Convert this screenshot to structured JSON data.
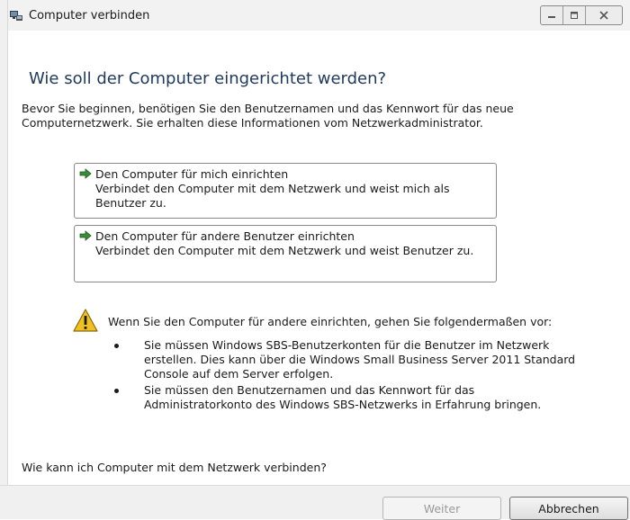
{
  "window": {
    "title": "Computer verbinden",
    "controls": [
      "minimize",
      "maximize",
      "close"
    ]
  },
  "page": {
    "heading": "Wie soll der Computer eingerichtet werden?",
    "intro": "Bevor Sie beginnen, benötigen Sie den Benutzernamen und das Kennwort für das neue Computernetzwerk. Sie erhalten diese Informationen vom Netzwerkadministrator."
  },
  "options": [
    {
      "title": "Den Computer für mich einrichten",
      "description": "Verbindet den Computer mit dem Netzwerk und weist mich als Benutzer zu."
    },
    {
      "title": "Den Computer für andere Benutzer einrichten",
      "description": "Verbindet den Computer mit dem Netzwerk und weist Benutzer zu."
    }
  ],
  "warning": {
    "text": "Wenn Sie den Computer für andere einrichten, gehen Sie folgendermaßen vor:",
    "bullets": [
      "Sie müssen Windows SBS-Benutzerkonten für die Benutzer im Netzwerk erstellen. Dies kann über die Windows Small Business Server 2011 Standard Console auf dem Server erfolgen.",
      "Sie müssen den Benutzernamen und das Kennwort für das Administratorkonto des Windows SBS-Netzwerks in Erfahrung bringen."
    ]
  },
  "help_link": "Wie kann ich Computer mit dem Netzwerk verbinden?",
  "buttons": {
    "next": "Weiter",
    "cancel": "Abbrechen",
    "next_enabled": false
  },
  "colors": {
    "heading": "#1e395b",
    "arrow": "#2a6a2a",
    "warning": "#f0c020"
  },
  "icons": {
    "app": "computer-network-icon",
    "option": "green-arrow-icon",
    "warning": "warning-triangle-icon"
  }
}
